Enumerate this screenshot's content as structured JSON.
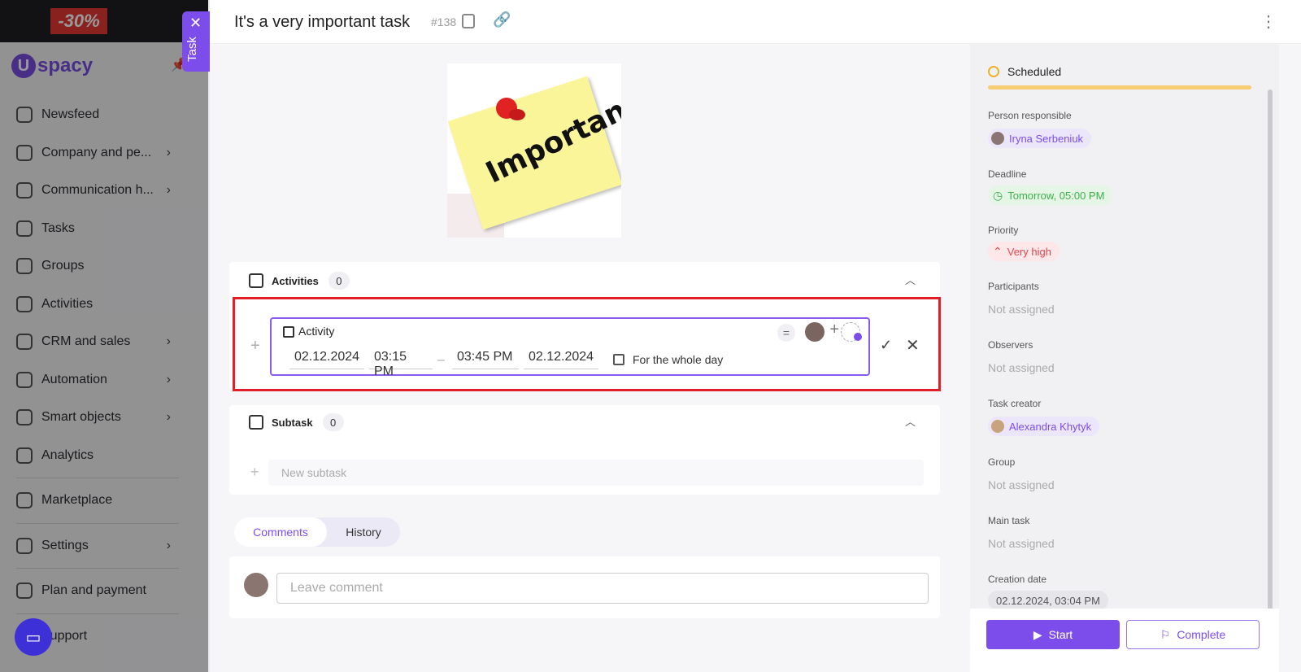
{
  "sidebar": {
    "promo": "-30%",
    "logo": "spacy",
    "logo_mark": "U",
    "items": [
      {
        "label": "Newsfeed",
        "icon": "newsfeed-icon"
      },
      {
        "label": "Company and pe...",
        "icon": "company-icon",
        "chevron": true
      },
      {
        "label": "Communication h...",
        "icon": "communication-icon",
        "chevron": true
      },
      {
        "label": "Tasks",
        "icon": "tasks-icon"
      },
      {
        "label": "Groups",
        "icon": "groups-icon"
      },
      {
        "label": "Activities",
        "icon": "activities-icon"
      },
      {
        "label": "CRM and sales",
        "icon": "crm-icon",
        "chevron": true
      },
      {
        "label": "Automation",
        "icon": "automation-icon",
        "chevron": true
      },
      {
        "label": "Smart objects",
        "icon": "smart-objects-icon",
        "chevron": true
      },
      {
        "label": "Analytics",
        "icon": "analytics-icon"
      },
      {
        "label": "Marketplace",
        "icon": "marketplace-icon"
      },
      {
        "label": "Settings",
        "icon": "settings-icon",
        "chevron": true
      },
      {
        "label": "Plan and payment",
        "icon": "payment-icon"
      },
      {
        "label": "Support",
        "icon": "support-icon"
      }
    ]
  },
  "task_tab": {
    "label": "Task",
    "close": "✕"
  },
  "header": {
    "title": "It's a very important task",
    "number": "#138",
    "menu": "⋮"
  },
  "image": {
    "sticky_text": "Important"
  },
  "activities": {
    "label": "Activities",
    "count": "0",
    "form": {
      "name": "Activity",
      "start_date": "02.12.2024",
      "start_time": "03:15 PM",
      "separator": "–",
      "end_time": "03:45 PM",
      "end_date": "02.12.2024",
      "whole_day_label": "For the whole day",
      "priority_symbol": "="
    }
  },
  "subtask": {
    "label": "Subtask",
    "count": "0",
    "placeholder": "New subtask"
  },
  "tabs": {
    "comments": "Comments",
    "history": "History"
  },
  "comment": {
    "placeholder": "Leave comment"
  },
  "info": {
    "status": "Scheduled",
    "person_responsible_label": "Person responsible",
    "person_responsible": "Iryna Serbeniuk",
    "deadline_label": "Deadline",
    "deadline": "Tomorrow, 05:00 PM",
    "priority_label": "Priority",
    "priority": "Very high",
    "participants_label": "Participants",
    "participants": "Not assigned",
    "observers_label": "Observers",
    "observers": "Not assigned",
    "task_creator_label": "Task creator",
    "task_creator": "Alexandra Khytyk",
    "group_label": "Group",
    "group": "Not assigned",
    "main_task_label": "Main task",
    "main_task": "Not assigned",
    "creation_date_label": "Creation date",
    "creation_date": "02.12.2024, 03:04 PM"
  },
  "footer": {
    "start": "Start",
    "complete": "Complete"
  },
  "colors": {
    "accent": "#7c4dea",
    "highlight": "#e21e2a",
    "status": "#f7cc72"
  }
}
